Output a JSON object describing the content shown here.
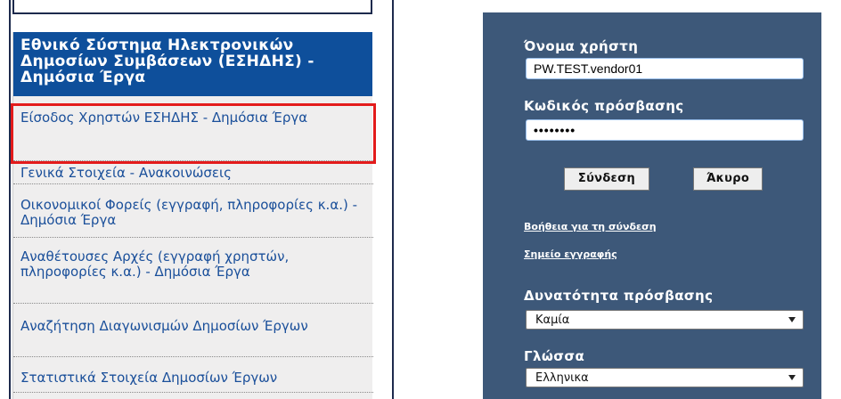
{
  "menu": {
    "header": "Εθνικό Σύστημα Ηλεκτρονικών Δημοσίων Συμβάσεων (ΕΣΗΔΗΣ) - Δημόσια Έργα",
    "items": [
      {
        "label": "Είσοδος Χρηστών ΕΣΗΔΗΣ - Δημόσια Έργα"
      },
      {
        "label": "Γενικά Στοιχεία - Ανακοινώσεις"
      },
      {
        "label": "Οικονομικοί Φορείς (εγγραφή, πληροφορίες κ.α.) - Δημόσια Έργα"
      },
      {
        "label": "Αναθέτουσες Αρχές (εγγραφή χρηστών, πληροφορίες κ.α.) - Δημόσια Έργα"
      },
      {
        "label": "Αναζήτηση Διαγωνισμών Δημοσίων Έργων"
      },
      {
        "label": "Στατιστικά Στοιχεία Δημοσίων Έργων"
      }
    ],
    "highlight_color": "#e31b1b"
  },
  "login": {
    "username_label": "Όνομα χρήστη",
    "username_value": "PW.TEST.vendor01",
    "password_label": "Κωδικός πρόσβασης",
    "password_value": "••••••••",
    "login_button": "Σύνδεση",
    "cancel_button": "Άκυρο",
    "help_link": "Βοήθεια για τη σύνδεση",
    "register_link": "Σημείο εγγραφής",
    "access_label": "Δυνατότητα πρόσβασης",
    "access_value": "Καμία",
    "language_label": "Γλώσσα",
    "language_value": "Ελληνικα",
    "panel_color": "#3d5879"
  }
}
